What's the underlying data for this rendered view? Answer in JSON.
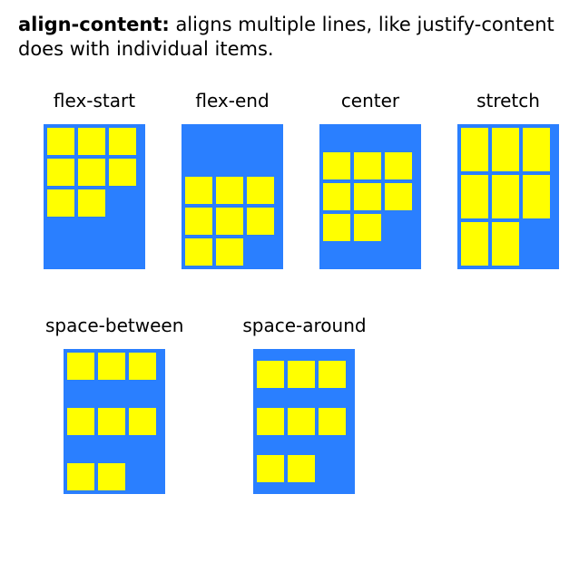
{
  "heading": {
    "property": "align-content:",
    "description": " aligns multiple lines, like justify-content does with individual items."
  },
  "colors": {
    "container": "#2a7fff",
    "item": "#ffff00"
  },
  "item_count": 8,
  "examples_row1": [
    {
      "label": "flex-start",
      "mode": "flex-start"
    },
    {
      "label": "flex-end",
      "mode": "flex-end"
    },
    {
      "label": "center",
      "mode": "center"
    },
    {
      "label": "stretch",
      "mode": "stretch"
    }
  ],
  "examples_row2": [
    {
      "label": "space-between",
      "mode": "space-between"
    },
    {
      "label": "space-around",
      "mode": "space-around"
    }
  ]
}
